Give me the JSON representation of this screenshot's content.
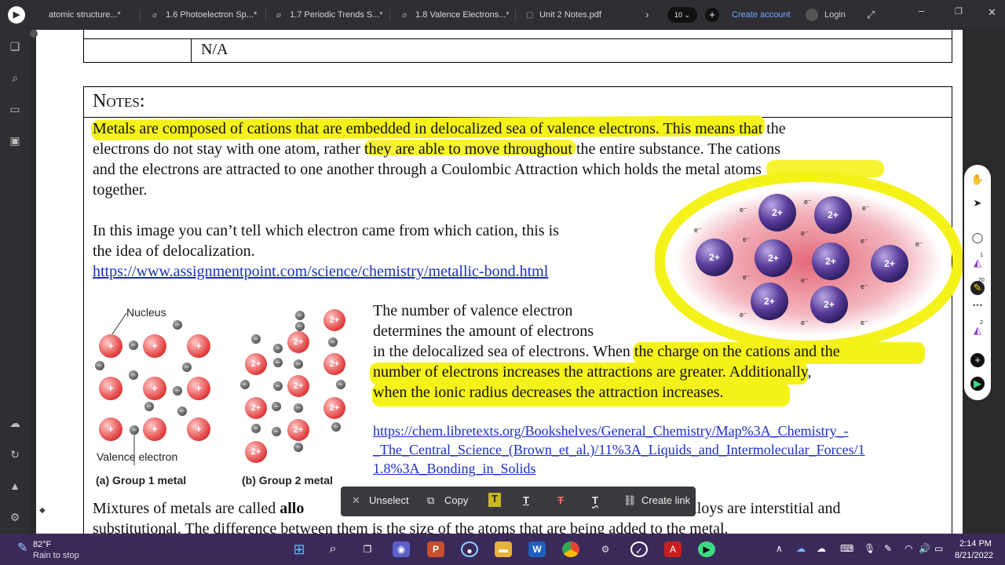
{
  "tabs": [
    {
      "label": "atomic structure...*"
    },
    {
      "label": "1.6 Photoelectron Sp...*"
    },
    {
      "label": "1.7 Periodic Trends S...*"
    },
    {
      "label": "1.8 Valence Electrons...*"
    },
    {
      "label": "Unit 2 Notes.pdf"
    }
  ],
  "topbar": {
    "zoom": "10",
    "create_account": "Create account",
    "login": "Login"
  },
  "document": {
    "prev_table_value": "N/A",
    "notes_heading": "Notes:",
    "para1": [
      "Metals are composed of cations that are embedded in delocalized sea of valence electrons.  This means that the",
      "electrons do not stay with one atom, rather they are able to move throughout the entire substance.  The cations",
      "and the electrons are attracted to one another through a Coulombic Attraction which holds the metal atoms",
      "together."
    ],
    "para2": [
      "In this image you can’t tell which electron came from which cation, this is",
      "the idea of delocalization."
    ],
    "link1": "https://www.assignmentpoint.com/science/chemistry/metallic-bond.html",
    "para3": [
      "The number of valence electron",
      "determines the amount of electrons",
      "in the delocalized sea of electrons.  When the charge on the cations and the",
      "number of electrons increases the attractions are greater.  Additionally,",
      "when the ionic radius decreases the attraction increases."
    ],
    "link2": [
      "https://chem.libretexts.org/Bookshelves/General_Chemistry/Map%3A_Chemistry_-",
      "_The_Central_Science_(Brown_et_al.)/11%3A_Liquids_and_Intermolecular_Forces/1",
      "1.8%3A_Bonding_in_Solids"
    ],
    "para4_start": "Mixtures of metals are called ",
    "para4_bold": "allo",
    "para4_end": "es of alloys are interstitial and",
    "para4_line2": "substitutional.  The difference between them is the size of the atoms that are being added to the metal.",
    "diagram": {
      "nucleus_label": "Nucleus",
      "valence_label": "Valence electron",
      "group1_label": "(a) Group 1 metal",
      "group2_label": "(b) Group 2 metal",
      "cation_plus": "+",
      "cation_2plus": "2+",
      "electron_symbol": "e⁻"
    }
  },
  "floatbar": {
    "unselect": "Unselect",
    "copy": "Copy",
    "create_link": "Create link"
  },
  "rightbar": {
    "badge1": "1",
    "badge2": "20",
    "badge3": "2"
  },
  "taskbar": {
    "temp": "82°F",
    "weather": "Rain to stop",
    "time": "2:14 PM",
    "date": "8/21/2022"
  },
  "colors": {
    "highlight": "#f5f21a",
    "link": "#1a2fbf",
    "accent": "#6fa8ff"
  }
}
